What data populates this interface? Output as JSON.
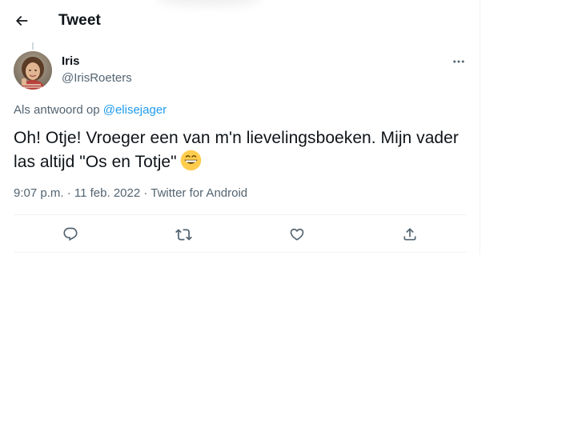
{
  "header": {
    "back_icon": "arrow-left-icon",
    "title": "Tweet"
  },
  "tweet": {
    "author": {
      "name": "Iris",
      "handle": "@IrisRoeters",
      "avatar_icon": "profile-photo"
    },
    "more_icon": "more-horizontal-icon",
    "reply_prefix": "Als antwoord op ",
    "reply_to": "@elisejager",
    "text": "Oh! Otje! Vroeger een van m'n lievelingsboeken. Mijn vader las altijd \"Os en Totje\"",
    "emoji": "grinning-face-emoji",
    "time": "9:07 p.m.",
    "date": "11 feb. 2022",
    "source": "Twitter for Android",
    "separator": " · "
  },
  "actions": {
    "reply_icon": "reply-icon",
    "retweet_icon": "retweet-icon",
    "like_icon": "heart-icon",
    "share_icon": "share-icon"
  },
  "colors": {
    "text_primary": "#0f1419",
    "text_secondary": "#536471",
    "link": "#1d9bf0",
    "divider": "#eff3f4"
  }
}
